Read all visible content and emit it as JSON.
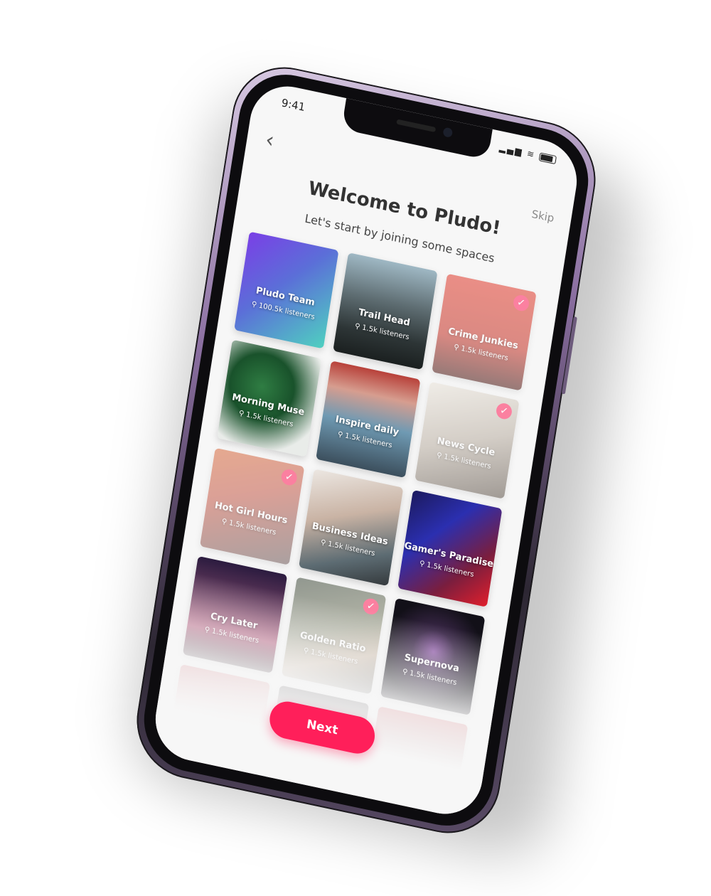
{
  "status_bar": {
    "time": "9:41",
    "icons": "▂▄▆ ≋"
  },
  "header": {
    "back_icon": "‹",
    "skip_label": "Skip",
    "title": "Welcome to Pludo!",
    "subtitle": "Let's start by joining some spaces"
  },
  "spaces": [
    {
      "name": "Pludo Team",
      "listeners": "100.5k listeners",
      "selected": false,
      "bg": "linear-gradient(135deg,#7a3fe6 0%,#5b6fd8 45%,#4fd0c0 100%)"
    },
    {
      "name": "Trail Head",
      "listeners": "1.5k listeners",
      "selected": false,
      "bg": "linear-gradient(180deg,#9fb8c4 0%,#5f6e73 40%,#2d3536 75%,#1b2020 100%)"
    },
    {
      "name": "Crime Junkies",
      "listeners": "1.5k listeners",
      "selected": true,
      "bg": "linear-gradient(180deg,#e0392a 0%,#c33024 60%,#4a1511 100%)"
    },
    {
      "name": "Morning Muse",
      "listeners": "1.5k listeners",
      "selected": false,
      "bg": "radial-gradient(circle at 40% 40%,#2f7d43 0%,#19522b 40%,#e9ece9 80%)"
    },
    {
      "name": "Inspire daily",
      "listeners": "1.5k listeners",
      "selected": false,
      "bg": "linear-gradient(180deg,#b8413a 0%,#d69d8f 25%,#6f9ab3 55%,#3c4f5d 100%)"
    },
    {
      "name": "News Cycle",
      "listeners": "1.5k listeners",
      "selected": true,
      "bg": "linear-gradient(160deg,#eae4da 0%,#b8ada0 50%,#5b5046 100%)"
    },
    {
      "name": "Hot Girl Hours",
      "listeners": "1.5k listeners",
      "selected": true,
      "bg": "linear-gradient(160deg,#d86a3c 0%,#c45a49 40%,#6d5a5a 100%)"
    },
    {
      "name": "Business Ideas",
      "listeners": "1.5k listeners",
      "selected": false,
      "bg": "linear-gradient(160deg,#ece7e2 0%,#c9b3a4 40%,#5d6c73 75%,#34393c 100%)"
    },
    {
      "name": "Gamer's Paradise",
      "listeners": "1.5k listeners",
      "selected": false,
      "bg": "linear-gradient(135deg,#1c1a5e 0%,#2b2fb0 35%,#7a1e3e 70%,#e01f2c 100%)"
    },
    {
      "name": "Cry Later",
      "listeners": "1.5k listeners",
      "selected": false,
      "bg": "linear-gradient(180deg,#2b1b3f 0%,#704062 40%,#b15a7b 70%,#3a2a33 100%)"
    },
    {
      "name": "Golden Ratio",
      "listeners": "1.5k listeners",
      "selected": true,
      "bg": "linear-gradient(160deg,#3f4a3b 0%,#7b7f66 45%,#b59c82 70%,#2d2c26 100%)"
    },
    {
      "name": "Supernova",
      "listeners": "1.5k listeners",
      "selected": false,
      "bg": "radial-gradient(circle at 50% 45%,#8f5aa8 0%,#3a2748 30%,#121018 70%)"
    },
    {
      "name": "",
      "listeners": "",
      "selected": false,
      "bg": "linear-gradient(160deg,#c2444c 0%,#e1b3b6 50%,#f7f7f7 100%)"
    },
    {
      "name": "",
      "listeners": "",
      "selected": false,
      "bg": "linear-gradient(180deg,#3a3438 0%,#9b8f92 50%,#f7f7f7 100%)"
    },
    {
      "name": "",
      "listeners": "",
      "selected": false,
      "bg": "linear-gradient(180deg,#c83b41 0%,#7a4b4f 50%,#f7f7f7 100%)"
    }
  ],
  "check_icon": "✓",
  "person_icon": "👤",
  "next_label": "Next",
  "colors": {
    "accent": "#ff1f5a",
    "frame": "#8a6ea0"
  }
}
